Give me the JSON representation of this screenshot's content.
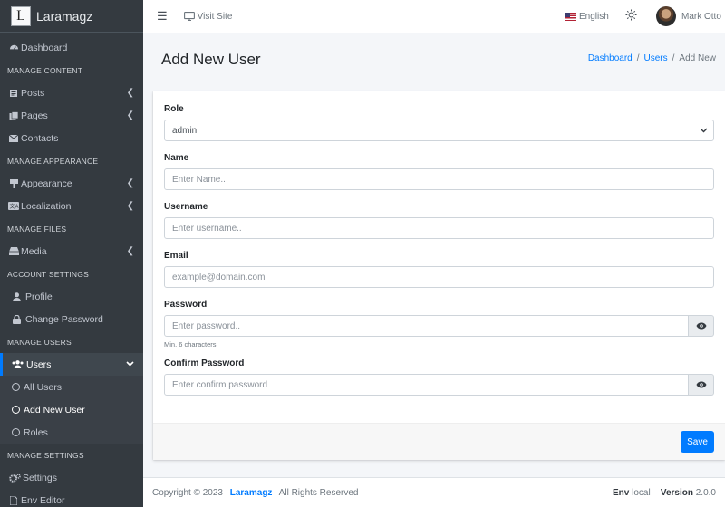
{
  "brand": {
    "logo_letter": "L",
    "name": "Laramagz"
  },
  "sidebar": {
    "dashboard": "Dashboard",
    "manage_content": "MANAGE CONTENT",
    "posts": "Posts",
    "pages": "Pages",
    "contacts": "Contacts",
    "manage_appearance": "MANAGE APPEARANCE",
    "appearance": "Appearance",
    "localization": "Localization",
    "manage_files": "MANAGE FILES",
    "media": "Media",
    "account_settings": "ACCOUNT SETTINGS",
    "profile": "Profile",
    "change_password": "Change Password",
    "manage_users": "MANAGE USERS",
    "users": "Users",
    "all_users": "All Users",
    "add_new_user": "Add New User",
    "roles": "Roles",
    "manage_settings": "MANAGE SETTINGS",
    "settings": "Settings",
    "env_editor": "Env Editor"
  },
  "topbar": {
    "visit_site": "Visit Site",
    "language": "English",
    "user_name": "Mark Otto"
  },
  "header": {
    "title": "Add New User",
    "breadcrumb": [
      "Dashboard",
      "Users",
      "Add New"
    ],
    "separator": "/"
  },
  "form": {
    "role_label": "Role",
    "role_value": "admin",
    "name_label": "Name",
    "name_placeholder": "Enter Name..",
    "username_label": "Username",
    "username_placeholder": "Enter username..",
    "email_label": "Email",
    "email_placeholder": "example@domain.com",
    "password_label": "Password",
    "password_placeholder": "Enter password..",
    "password_hint": "Min. 6 characters",
    "confirm_label": "Confirm Password",
    "confirm_placeholder": "Enter confirm password",
    "save_label": "Save"
  },
  "footer": {
    "copyright": "Copyright © 2023",
    "brand": "Laramagz",
    "rights": "All Rights Reserved",
    "env_label": "Env",
    "env_value": "local",
    "version_label": "Version",
    "version_value": "2.0.0"
  },
  "colors": {
    "primary": "#007bff",
    "sidebar_bg": "#343a40"
  }
}
